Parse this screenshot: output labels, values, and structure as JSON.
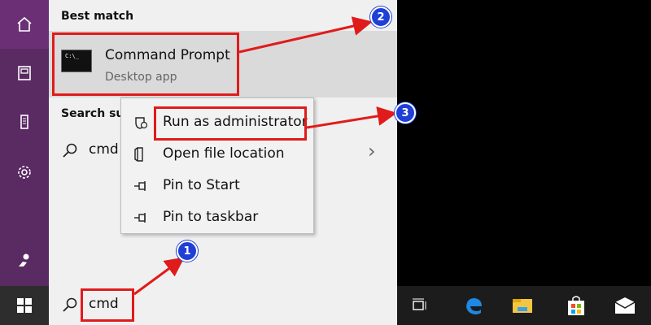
{
  "rail": {
    "items": [
      {
        "icon": "home-icon"
      },
      {
        "icon": "documents-icon"
      },
      {
        "icon": "device-icon"
      },
      {
        "icon": "settings-gear-icon"
      },
      {
        "icon": "user-icon"
      }
    ]
  },
  "best_match": {
    "label": "Best match",
    "app_title": "Command Prompt",
    "app_sub": "Desktop app",
    "app_icon_text": "C:\\_"
  },
  "suggestions": {
    "label": "Search sug",
    "items": [
      {
        "text": "cmd"
      }
    ]
  },
  "context_menu": {
    "items": [
      {
        "label": "Run as administrator",
        "icon": "shield-icon"
      },
      {
        "label": "Open file location",
        "icon": "folder-icon"
      },
      {
        "label": "Pin to Start",
        "icon": "pin-icon"
      },
      {
        "label": "Pin to taskbar",
        "icon": "pin-icon"
      }
    ]
  },
  "searchbar": {
    "value": "cmd"
  },
  "taskbar": {
    "icons": [
      "task-view-icon",
      "edge-icon",
      "file-explorer-icon",
      "store-icon",
      "mail-icon"
    ]
  },
  "annotations": {
    "badges": [
      "1",
      "2",
      "3"
    ],
    "accent_red": "#e01b1b",
    "badge_blue": "#1f3fd6"
  }
}
